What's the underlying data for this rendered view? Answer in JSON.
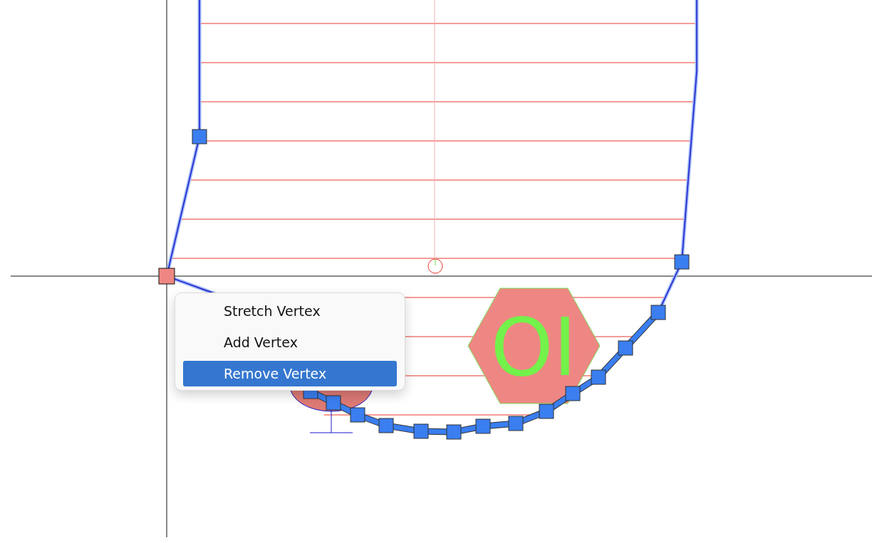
{
  "canvas": {
    "hexagon_label": "OI"
  },
  "context_menu": {
    "items": [
      {
        "label": "Stretch Vertex",
        "selected": false
      },
      {
        "label": "Add Vertex",
        "selected": false
      },
      {
        "label": "Remove Vertex",
        "selected": true
      }
    ]
  }
}
